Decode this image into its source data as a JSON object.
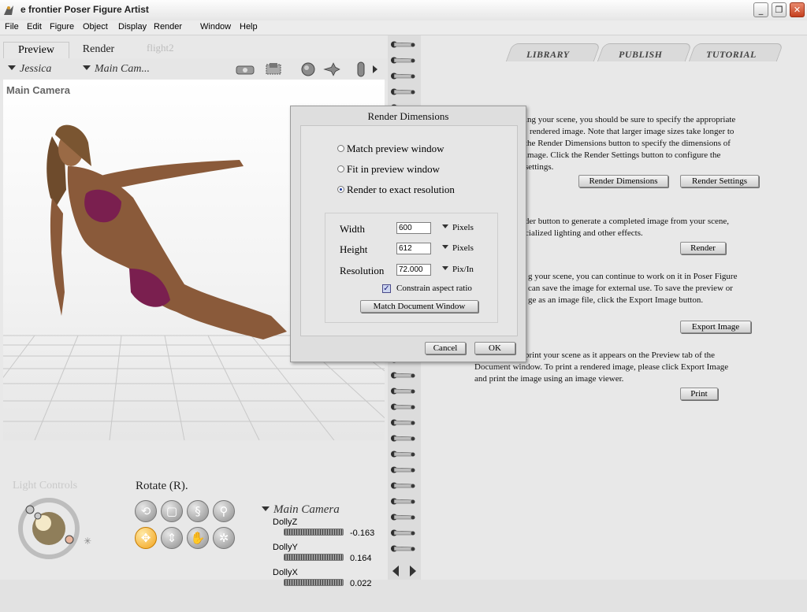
{
  "window": {
    "title": "e frontier Poser Figure Artist",
    "minimize": "_",
    "maximize": "❐",
    "close": "✕"
  },
  "menu": [
    "File",
    "Edit",
    "Figure",
    "Object",
    "Display",
    "Render",
    "Window",
    "Help"
  ],
  "left": {
    "tabs": [
      "Preview",
      "Render"
    ],
    "doc_tab_ghost": "flight2",
    "figure_dropdown": "Jessica",
    "camera_dropdown": "Main Cam...",
    "viewport_label": "Main Camera",
    "light_controls": "Light Controls",
    "rotate_label": "Rotate (R).",
    "param_title": "Main Camera",
    "params": [
      {
        "name": "DollyZ",
        "value": "-0.163"
      },
      {
        "name": "DollyY",
        "value": "0.164"
      },
      {
        "name": "DollyX",
        "value": "0.022"
      }
    ]
  },
  "right": {
    "tabs": [
      "LIBRARY",
      "PUBLISH",
      "TUTORIAL"
    ],
    "para1": [
      "ing your scene, you should be sure to specify the appropriate",
      "rendered image.  Note that larger image sizes take longer to",
      "the Render Dimensions button to specify the dimensions of",
      "image.  Click the Render Settings button to configure the",
      "settings."
    ],
    "para2": [
      "der button to generate a completed image from your scene,",
      "cialized lighting and other effects."
    ],
    "para3": [
      "g your scene, you can continue to work on it in Poser Figure",
      "can save the image for external use. To save the preview or",
      "ge as an image file, click the Export Image button."
    ],
    "para4": [
      "print your scene as it appears on the Preview tab of the",
      "Document window. To print a rendered image, please click Export Image",
      "and print the image using an image viewer."
    ],
    "buttons": {
      "render_dimensions": "Render Dimensions",
      "render_settings": "Render Settings",
      "render": "Render",
      "export_image": "Export Image",
      "print": "Print"
    }
  },
  "dialog": {
    "title": "Render Dimensions",
    "options": [
      "Match preview window",
      "Fit in preview window",
      "Render to exact resolution"
    ],
    "selected_option": "Render to exact resolution",
    "width_label": "Width",
    "width": "600",
    "width_unit": "Pixels",
    "height_label": "Height",
    "height": "612",
    "height_unit": "Pixels",
    "resolution_label": "Resolution",
    "resolution": "72.000",
    "resolution_unit": "Pix/In",
    "constrain_label": "Constrain aspect ratio",
    "constrain_checked": true,
    "match_button": "Match Document Window",
    "cancel": "Cancel",
    "ok": "OK"
  },
  "colors": {
    "accent_orange": "#f2a21a",
    "skin": "#8a5a3a",
    "bikini": "#7a1f4f"
  }
}
